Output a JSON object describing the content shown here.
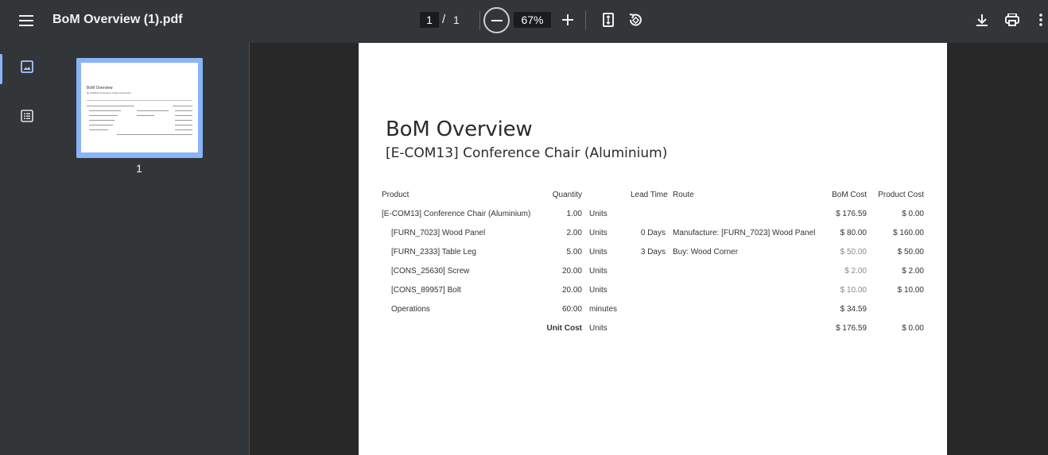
{
  "toolbar": {
    "title": "BoM Overview (1).pdf",
    "page_current": "1",
    "page_separator": "/",
    "page_total": "1",
    "zoom": "67%"
  },
  "sidebar": {
    "thumbnail_label": "1",
    "thumbnail_title": "BoM Overview",
    "thumbnail_subtitle": "[E-COM13] Conference Chair (Aluminium)"
  },
  "report": {
    "title": "BoM Overview",
    "subtitle": "[E-COM13] Conference Chair (Aluminium)",
    "headers": {
      "product": "Product",
      "quantity": "Quantity",
      "lead_time": "Lead Time",
      "route": "Route",
      "bom_cost": "BoM Cost",
      "product_cost": "Product Cost"
    },
    "rows": [
      {
        "product": "[E-COM13] Conference Chair (Aluminium)",
        "quantity": "1.00",
        "unit": "Units",
        "lead_time": "",
        "route": "",
        "bom_cost": "$ 176.59",
        "product_cost": "$ 0.00"
      },
      {
        "product": "[FURN_7023] Wood Panel",
        "quantity": "2.00",
        "unit": "Units",
        "lead_time": "0 Days",
        "route": "Manufacture: [FURN_7023] Wood Panel",
        "bom_cost": "$ 80.00",
        "product_cost": "$ 160.00"
      },
      {
        "product": "[FURN_2333] Table Leg",
        "quantity": "5.00",
        "unit": "Units",
        "lead_time": "3 Days",
        "route": "Buy: Wood Corner",
        "bom_cost": "$ 50.00",
        "product_cost": "$ 50.00"
      },
      {
        "product": "[CONS_25630] Screw",
        "quantity": "20.00",
        "unit": "Units",
        "lead_time": "",
        "route": "",
        "bom_cost": "$ 2.00",
        "product_cost": "$ 2.00"
      },
      {
        "product": "[CONS_89957] Bolt",
        "quantity": "20.00",
        "unit": "Units",
        "lead_time": "",
        "route": "",
        "bom_cost": "$ 10.00",
        "product_cost": "$ 10.00"
      },
      {
        "product": "Operations",
        "quantity": "60:00",
        "unit": "minutes",
        "lead_time": "",
        "route": "",
        "bom_cost": "$ 34.59",
        "product_cost": ""
      }
    ],
    "footer": {
      "label": "Unit Cost",
      "unit": "Units",
      "bom_cost": "$ 176.59",
      "product_cost": "$ 0.00"
    }
  }
}
